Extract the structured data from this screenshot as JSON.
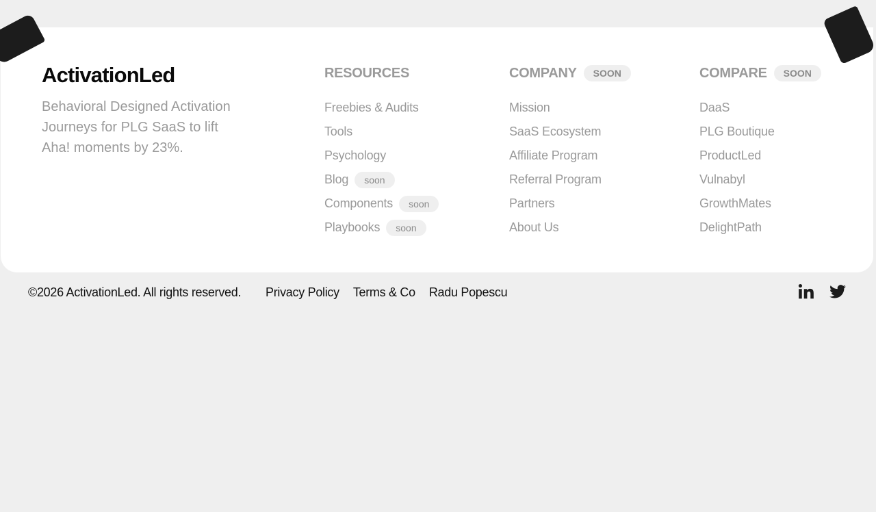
{
  "brand": {
    "title": "ActivationLed",
    "tagline": "Behavioral Designed Activation Journeys for PLG SaaS to lift Aha! moments by 23%."
  },
  "columns": [
    {
      "heading": "RESOURCES",
      "badge": "",
      "links": [
        {
          "label": "Freebies & Audits",
          "badge": ""
        },
        {
          "label": "Tools",
          "badge": ""
        },
        {
          "label": "Psychology",
          "badge": ""
        },
        {
          "label": "Blog",
          "badge": "soon"
        },
        {
          "label": "Components",
          "badge": "soon"
        },
        {
          "label": "Playbooks",
          "badge": "soon"
        }
      ]
    },
    {
      "heading": "COMPANY",
      "badge": "SOON",
      "links": [
        {
          "label": "Mission",
          "badge": ""
        },
        {
          "label": "SaaS Ecosystem",
          "badge": ""
        },
        {
          "label": "Affiliate Program",
          "badge": ""
        },
        {
          "label": "Referral Program",
          "badge": ""
        },
        {
          "label": "Partners",
          "badge": ""
        },
        {
          "label": "About Us",
          "badge": ""
        }
      ]
    },
    {
      "heading": "COMPARE",
      "badge": "SOON",
      "links": [
        {
          "label": "DaaS",
          "badge": ""
        },
        {
          "label": "PLG Boutique",
          "badge": ""
        },
        {
          "label": "ProductLed",
          "badge": ""
        },
        {
          "label": "Vulnabyl",
          "badge": ""
        },
        {
          "label": "GrowthMates",
          "badge": ""
        },
        {
          "label": "DelightPath",
          "badge": ""
        }
      ]
    }
  ],
  "bottom": {
    "copyright": "©2026 ActivationLed. All rights reserved.",
    "privacy": "Privacy Policy",
    "terms": "Terms & Co",
    "author": "Radu Popescu"
  },
  "social": {
    "linkedin_icon": "linkedin-icon",
    "twitter_icon": "twitter-icon"
  },
  "colors": {
    "background": "#efefef",
    "card": "#ffffff",
    "muted_text": "#9a9a9a",
    "dark_text": "#0a0a0a"
  }
}
